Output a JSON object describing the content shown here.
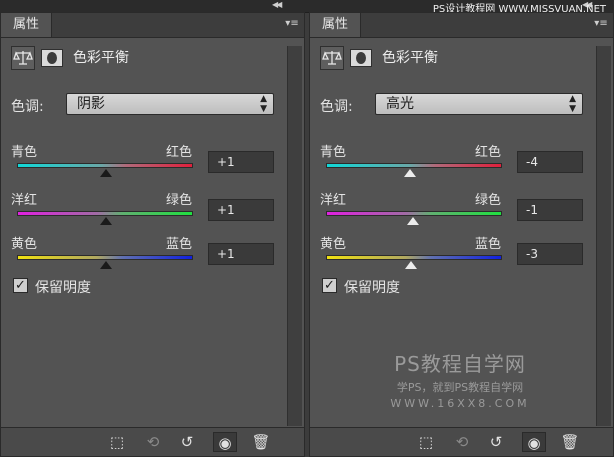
{
  "top_watermark": "PS设计教程网 WWW.MISSVUAN.NET",
  "panels": [
    {
      "tab_label": "属性",
      "title": "色彩平衡",
      "tone_label": "色调:",
      "tone_value": "阴影",
      "sliders": [
        {
          "left": "青色",
          "right": "红色",
          "value_text": "+1",
          "value": 1
        },
        {
          "left": "洋红",
          "right": "绿色",
          "value_text": "+1",
          "value": 1
        },
        {
          "left": "黄色",
          "right": "蓝色",
          "value_text": "+1",
          "value": 1
        }
      ],
      "preserve_label": "保留明度",
      "preserve_checked": true,
      "checkmark": "✓"
    },
    {
      "tab_label": "属性",
      "title": "色彩平衡",
      "tone_label": "色调:",
      "tone_value": "高光",
      "sliders": [
        {
          "left": "青色",
          "right": "红色",
          "value_text": "-4",
          "value": -4
        },
        {
          "left": "洋红",
          "right": "绿色",
          "value_text": "-1",
          "value": -1
        },
        {
          "left": "黄色",
          "right": "蓝色",
          "value_text": "-3",
          "value": -3
        }
      ],
      "preserve_label": "保留明度",
      "preserve_checked": true,
      "checkmark": "✓"
    }
  ],
  "watermark": {
    "title": "PS教程自学网",
    "subtitle": "学PS，就到PS教程自学网",
    "url": "WWW.16XX8.COM"
  },
  "icons": {
    "collapse": "◀◀",
    "menu": "▾≡",
    "scale": "⚖",
    "clip": "⬚",
    "view_prev": "⟲",
    "reset": "↺",
    "eye": "◉",
    "trash": "🗑",
    "select_up": "▲",
    "select_down": "▼"
  },
  "colors": {
    "panel_bg": "#535353",
    "accent_cyan": "#10d8d8",
    "accent_red": "#e0203c"
  }
}
